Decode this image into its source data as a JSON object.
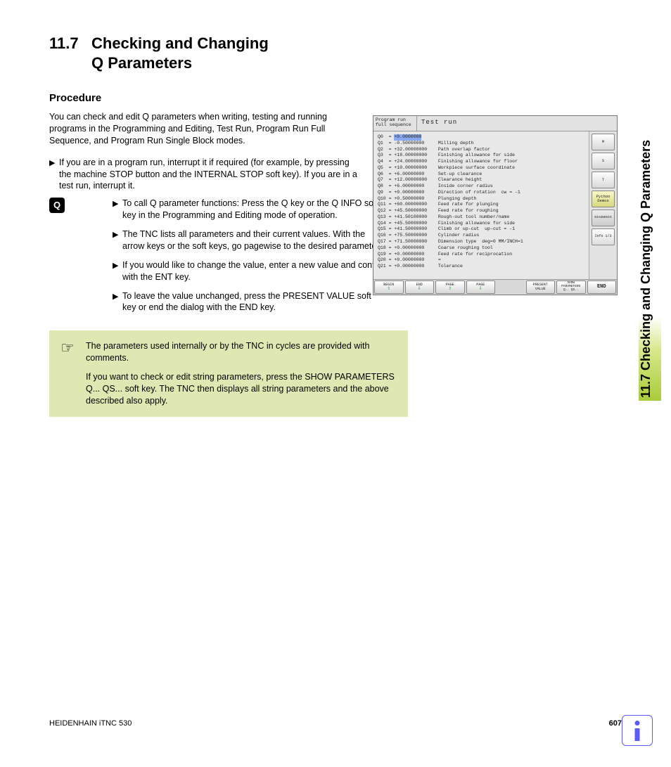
{
  "heading": {
    "number": "11.7",
    "title_line1": "Checking and Changing",
    "title_line2": "Q Parameters"
  },
  "subheading": "Procedure",
  "intro": "You can check and edit Q parameters when writing, testing and running programs in the Programming and Editing, Test Run, Program Run Full Sequence, and Program Run Single Block modes.",
  "bullet1": "If you are in a program run, interrupt it if required (for example, by pressing the machine STOP button and the INTERNAL STOP soft key). If you are in a test run, interrupt it.",
  "q_badge": "Q",
  "q_steps": [
    "To call Q parameter functions: Press the Q key or the Q INFO soft key in the Programming and Editing mode of operation.",
    "The TNC lists all parameters and their current values. With the arrow keys or the soft keys, go pagewise to the desired parameters.",
    "If you would like to change the value, enter a new value and confirm with the ENT key.",
    "To leave the value unchanged, press the PRESENT VALUE soft key or end the dialog with the END key."
  ],
  "note": {
    "p1": "The parameters used internally or by the TNC in cycles are provided with comments.",
    "p2": "If you want to check or edit string parameters, press the SHOW PARAMETERS Q... QS... soft key. The TNC then displays all string parameters and the above described also apply."
  },
  "side_tab": "11.7 Checking and Changing Q Parameters",
  "footer": {
    "left": "HEIDENHAIN iTNC 530",
    "page": "607"
  },
  "screenshot": {
    "mode_line1": "Program run",
    "mode_line2": "full sequence",
    "title": "Test run",
    "rows": [
      {
        "q": "Q0",
        "val": "+0.0000000",
        "desc": "",
        "hl": true
      },
      {
        "q": "Q1",
        "val": "-0.50000000",
        "desc": "Milling depth"
      },
      {
        "q": "Q2",
        "val": "+32.00000000",
        "desc": "Path overlap factor"
      },
      {
        "q": "Q3",
        "val": "+18.00000000",
        "desc": "Finishing allowance for side"
      },
      {
        "q": "Q4",
        "val": "+24.00000000",
        "desc": "Finishing allowance for floor"
      },
      {
        "q": "Q5",
        "val": "+10.00000000",
        "desc": "Workpiece surface coordinate"
      },
      {
        "q": "Q6",
        "val": "+6.00000000",
        "desc": "Set-up clearance"
      },
      {
        "q": "Q7",
        "val": "+12.00000000",
        "desc": "Clearance height"
      },
      {
        "q": "Q8",
        "val": "+6.00000000",
        "desc": "Inside corner radius"
      },
      {
        "q": "Q9",
        "val": "+0.00000000",
        "desc": "Direction of rotation  cw = -1"
      },
      {
        "q": "Q10",
        "val": "+0.50000000",
        "desc": "Plunging depth"
      },
      {
        "q": "Q11",
        "val": "+60.00000000",
        "desc": "Feed rate for plunging"
      },
      {
        "q": "Q12",
        "val": "+45.50000000",
        "desc": "Feed rate for roughing"
      },
      {
        "q": "Q13",
        "val": "+41.50100000",
        "desc": "Rough-out tool number/name"
      },
      {
        "q": "Q14",
        "val": "+45.50000000",
        "desc": "Finishing allowance for side"
      },
      {
        "q": "Q15",
        "val": "+41.50000000",
        "desc": "Climb or up-cut  up-cut = -1"
      },
      {
        "q": "Q16",
        "val": "+75.50000000",
        "desc": "Cylinder radius"
      },
      {
        "q": "Q17",
        "val": "+71.50000000",
        "desc": "Dimension type  deg=0 MM/INCH=1"
      },
      {
        "q": "Q18",
        "val": "+0.00000000",
        "desc": "Coarse roughing tool"
      },
      {
        "q": "Q19",
        "val": "+0.00000000",
        "desc": "Feed rate for reciprocation"
      },
      {
        "q": "Q20",
        "val": "+0.00000000",
        "desc": "="
      },
      {
        "q": "Q21",
        "val": "+0.00000000",
        "desc": "Tolerance"
      }
    ],
    "side_buttons": [
      {
        "label": "M",
        "kind": "plain"
      },
      {
        "label": "S",
        "kind": "plain"
      },
      {
        "label": "T",
        "kind": "plain"
      },
      {
        "label": "Python\nDemos",
        "kind": "py"
      },
      {
        "label": "DIAGNOSIS",
        "kind": "diag"
      },
      {
        "label": "Info 1/3",
        "kind": "info"
      }
    ],
    "softkeys": {
      "begin": "BEGIN",
      "end": "END",
      "page_up": "PAGE",
      "page_dn": "PAGE",
      "present": "PRESENT\nVALUE",
      "show": "SHOW\nPARAMETERS\nQ.. QS..",
      "endk": "END"
    }
  }
}
